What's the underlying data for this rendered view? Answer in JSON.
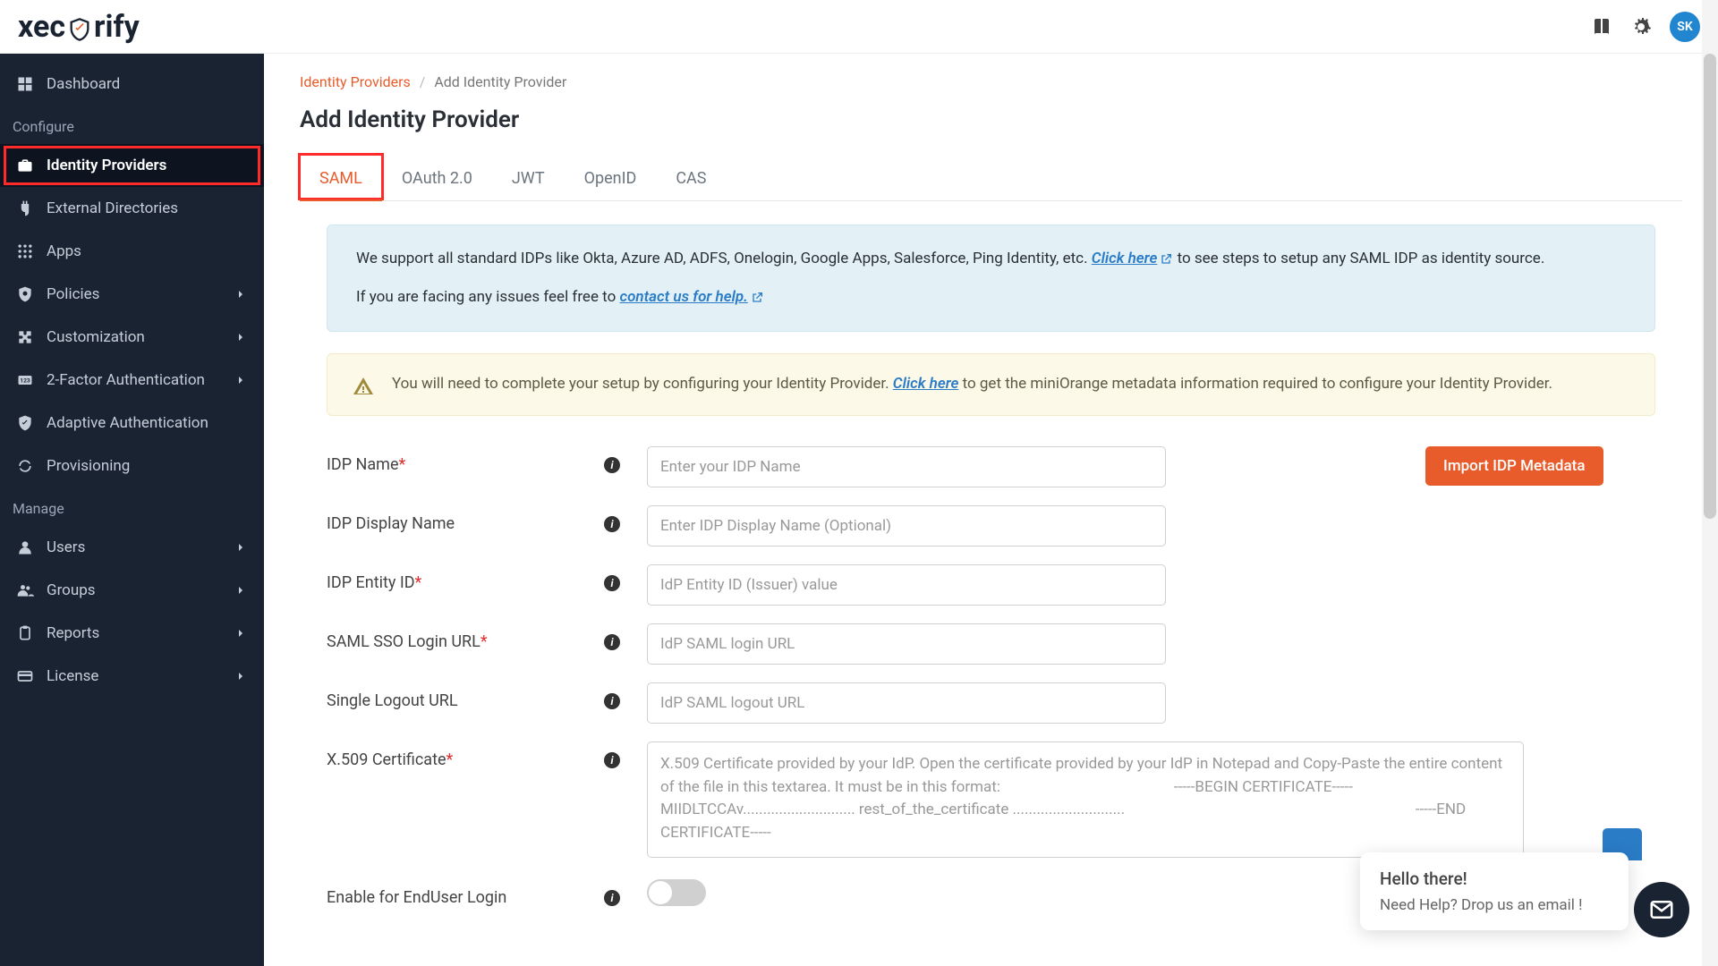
{
  "brand": {
    "name_pre": "xec",
    "name_post": "rify",
    "avatar": "SK"
  },
  "sidebar": {
    "groups": [
      {
        "items": [
          {
            "label": "Dashboard",
            "icon": "dashboard"
          }
        ]
      },
      {
        "header": "Configure",
        "items": [
          {
            "label": "Identity Providers",
            "icon": "briefcase",
            "active": true,
            "highlight": true
          },
          {
            "label": "External Directories",
            "icon": "plug"
          },
          {
            "label": "Apps",
            "icon": "grid"
          },
          {
            "label": "Policies",
            "icon": "shield",
            "chevron": true
          },
          {
            "label": "Customization",
            "icon": "puzzle",
            "chevron": true
          },
          {
            "label": "2-Factor Authentication",
            "icon": "2fa",
            "chevron": true
          },
          {
            "label": "Adaptive Authentication",
            "icon": "verified"
          },
          {
            "label": "Provisioning",
            "icon": "sync"
          }
        ]
      },
      {
        "header": "Manage",
        "items": [
          {
            "label": "Users",
            "icon": "user",
            "chevron": true
          },
          {
            "label": "Groups",
            "icon": "group",
            "chevron": true
          },
          {
            "label": "Reports",
            "icon": "clipboard",
            "chevron": true
          },
          {
            "label": "License",
            "icon": "card",
            "chevron": true
          }
        ]
      }
    ]
  },
  "breadcrumb": {
    "root": "Identity Providers",
    "current": "Add Identity Provider"
  },
  "page": {
    "title": "Add Identity Provider"
  },
  "tabs": [
    {
      "label": "SAML",
      "active": true,
      "highlight": true
    },
    {
      "label": "OAuth 2.0"
    },
    {
      "label": "JWT"
    },
    {
      "label": "OpenID"
    },
    {
      "label": "CAS"
    }
  ],
  "info": {
    "text1": "We support all standard IDPs like Okta, Azure AD, ADFS, Onelogin, Google Apps, Salesforce, Ping Identity, etc. ",
    "link1": "Click here",
    "text2": " to see steps to setup any SAML IDP as identity source.",
    "text3": "If you are facing any issues feel free to ",
    "link2": "contact us for help."
  },
  "warn": {
    "text1": "You will need to complete your setup by configuring your Identity Provider. ",
    "link": "Click here",
    "text2": " to get the miniOrange metadata information required to configure your Identity Provider."
  },
  "form": {
    "import_btn": "Import IDP Metadata",
    "fields": [
      {
        "label": "IDP Name",
        "required": true,
        "placeholder": "Enter your IDP Name",
        "type": "text"
      },
      {
        "label": "IDP Display Name",
        "required": false,
        "placeholder": "Enter IDP Display Name (Optional)",
        "type": "text"
      },
      {
        "label": "IDP Entity ID",
        "required": true,
        "placeholder": "IdP Entity ID (Issuer) value",
        "type": "text"
      },
      {
        "label": "SAML SSO Login URL",
        "required": true,
        "placeholder": "IdP SAML login URL",
        "type": "text"
      },
      {
        "label": "Single Logout URL",
        "required": false,
        "placeholder": "IdP SAML logout URL",
        "type": "text"
      },
      {
        "label": "X.509 Certificate",
        "required": true,
        "placeholder": "X.509 Certificate provided by your IdP. Open the certificate provided by your IdP in Notepad and Copy-Paste the entire content of the file in this textarea. It must be in this format:                                              -----BEGIN CERTIFICATE-----                                                                                                                               MIIDLTCCAv............................ rest_of_the_certificate ............................                                                                             -----END CERTIFICATE-----",
        "type": "textarea"
      },
      {
        "label": "Enable for EndUser Login",
        "required": false,
        "type": "toggle"
      }
    ]
  },
  "chat": {
    "title": "Hello there!",
    "sub": "Need Help? Drop us an email !"
  }
}
